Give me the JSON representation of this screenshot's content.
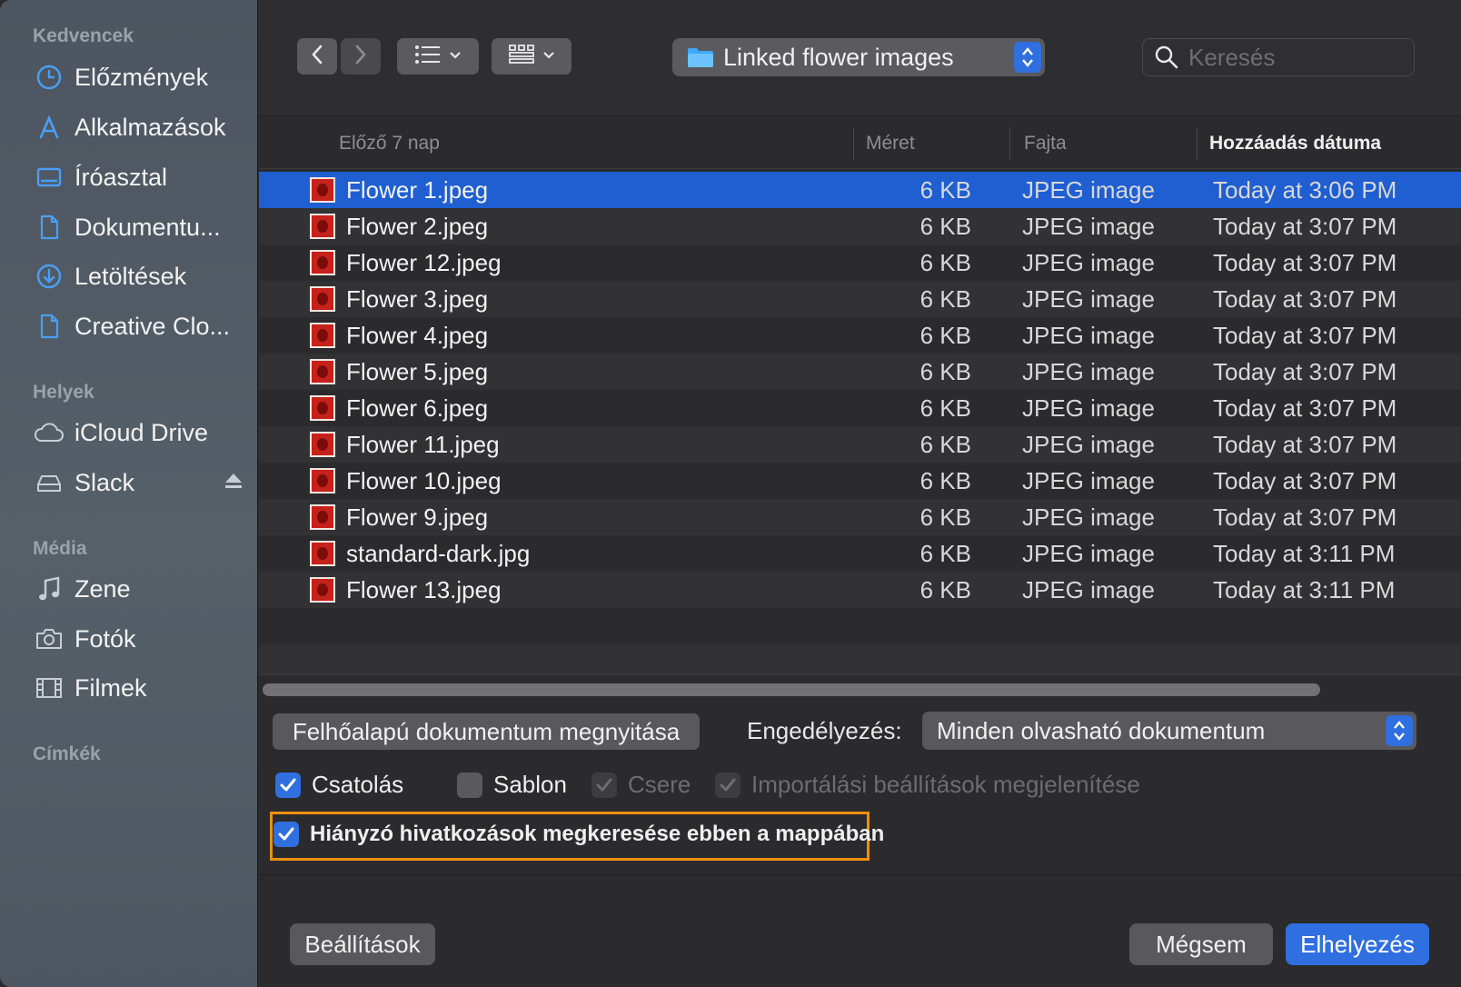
{
  "sidebar": {
    "sections": [
      {
        "title": "Kedvencek",
        "items": [
          {
            "label": "Előzmények",
            "icon": "clock-icon"
          },
          {
            "label": "Alkalmazások",
            "icon": "applications-icon"
          },
          {
            "label": "Íróasztal",
            "icon": "desktop-icon"
          },
          {
            "label": "Dokumentu...",
            "icon": "document-icon"
          },
          {
            "label": "Letöltések",
            "icon": "download-icon"
          },
          {
            "label": "Creative Clo...",
            "icon": "document-icon"
          }
        ]
      },
      {
        "title": "Helyek",
        "items": [
          {
            "label": "iCloud Drive",
            "icon": "cloud-icon"
          },
          {
            "label": "Slack",
            "icon": "drive-icon",
            "eject": "eject-icon"
          }
        ]
      },
      {
        "title": "Média",
        "items": [
          {
            "label": "Zene",
            "icon": "music-note-icon"
          },
          {
            "label": "Fotók",
            "icon": "camera-icon"
          },
          {
            "label": "Filmek",
            "icon": "film-icon"
          }
        ]
      },
      {
        "title": "Címkék",
        "items": []
      }
    ]
  },
  "toolbar": {
    "path_title": "Linked flower images",
    "search_placeholder": "Keresés"
  },
  "table": {
    "columns": [
      "Előző 7 nap",
      "Méret",
      "Fajta",
      "Hozzáadás dátuma"
    ],
    "rows": [
      {
        "name": "Flower 1.jpeg",
        "size": "6 KB",
        "kind": "JPEG image",
        "date": "Today at 3:06 PM",
        "selected": true
      },
      {
        "name": "Flower 2.jpeg",
        "size": "6 KB",
        "kind": "JPEG image",
        "date": "Today at 3:07 PM"
      },
      {
        "name": "Flower 12.jpeg",
        "size": "6 KB",
        "kind": "JPEG image",
        "date": "Today at 3:07 PM"
      },
      {
        "name": "Flower 3.jpeg",
        "size": "6 KB",
        "kind": "JPEG image",
        "date": "Today at 3:07 PM"
      },
      {
        "name": "Flower 4.jpeg",
        "size": "6 KB",
        "kind": "JPEG image",
        "date": "Today at 3:07 PM"
      },
      {
        "name": "Flower 5.jpeg",
        "size": "6 KB",
        "kind": "JPEG image",
        "date": "Today at 3:07 PM"
      },
      {
        "name": "Flower 6.jpeg",
        "size": "6 KB",
        "kind": "JPEG image",
        "date": "Today at 3:07 PM"
      },
      {
        "name": "Flower 11.jpeg",
        "size": "6 KB",
        "kind": "JPEG image",
        "date": "Today at 3:07 PM"
      },
      {
        "name": "Flower 10.jpeg",
        "size": "6 KB",
        "kind": "JPEG image",
        "date": "Today at 3:07 PM"
      },
      {
        "name": "Flower 9.jpeg",
        "size": "6 KB",
        "kind": "JPEG image",
        "date": "Today at 3:07 PM"
      },
      {
        "name": "standard-dark.jpg",
        "size": "6 KB",
        "kind": "JPEG image",
        "date": "Today at 3:11 PM"
      },
      {
        "name": "Flower 13.jpeg",
        "size": "6 KB",
        "kind": "JPEG image",
        "date": "Today at 3:11 PM"
      }
    ]
  },
  "options": {
    "cloud_button": "Felhőalapú dokumentum megnyitása",
    "permission_label": "Engedélyezés:",
    "permission_value": "Minden olvasható dokumentum",
    "checkboxes": [
      {
        "label": "Csatolás",
        "state": "checked"
      },
      {
        "label": "Sablon",
        "state": "unchecked"
      },
      {
        "label": "Csere",
        "state": "disabled-checked"
      },
      {
        "label": "Importálási beállítások megjelenítése",
        "state": "disabled-checked"
      }
    ],
    "missing_links": {
      "label": "Hiányzó hivatkozások megkeresése ebben a mappában",
      "state": "checked"
    }
  },
  "footer": {
    "settings": "Beállítások",
    "cancel": "Mégsem",
    "place": "Elhelyezés"
  },
  "colors": {
    "accent": "#2f6fe0",
    "selection": "#1f5fd1",
    "highlight_border": "#f1900c",
    "sidebar_icon": "#4a9ff5"
  }
}
